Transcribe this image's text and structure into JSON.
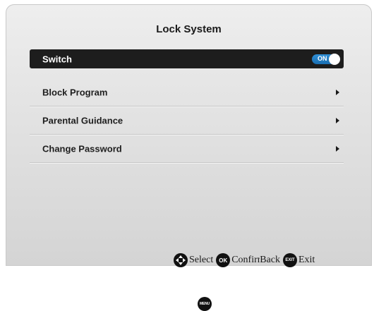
{
  "title": "Lock System",
  "menu": {
    "items": [
      {
        "label": "Switch",
        "toggle": "ON",
        "selected": true
      },
      {
        "label": "Block Program"
      },
      {
        "label": "Parental Guidance"
      },
      {
        "label": "Change Password"
      }
    ]
  },
  "footer": {
    "select": {
      "icon": "dpad-icon",
      "label": "Select"
    },
    "confirm": {
      "badge": "OK",
      "label": "Confirm"
    },
    "back": {
      "badge": "MENU",
      "label": "Back"
    },
    "exit": {
      "badge": "EXIT",
      "label": "Exit"
    }
  },
  "colors": {
    "selected_row": "#1d1d1d",
    "toggle_on": "#1a6fb2"
  }
}
